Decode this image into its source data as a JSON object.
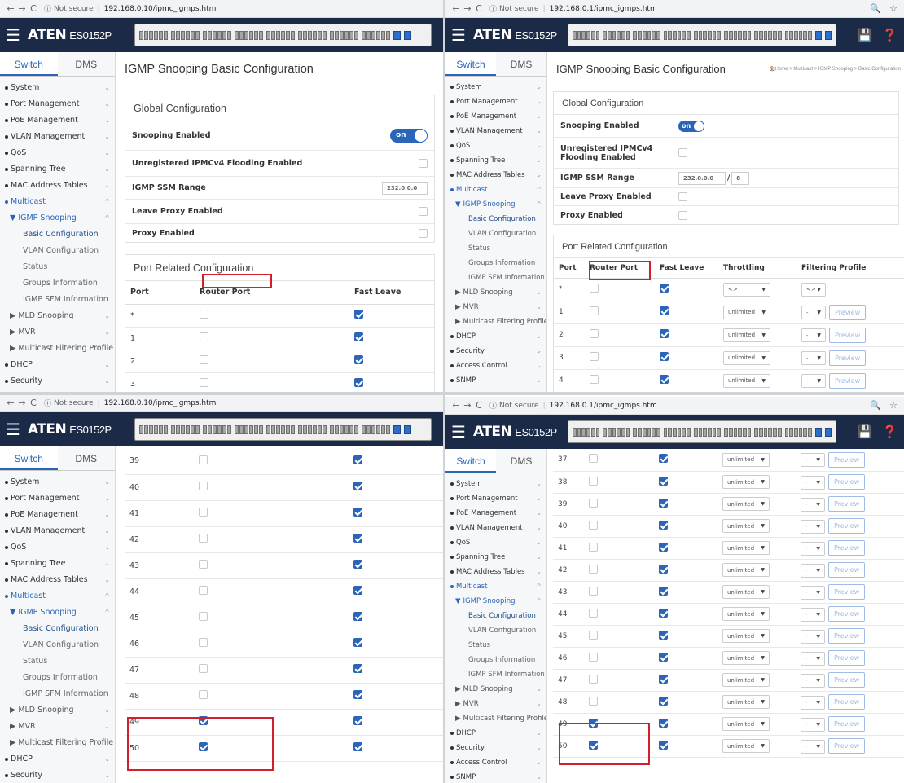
{
  "browser": {
    "q1": {
      "back": "←",
      "fwd": "→",
      "reload": "C",
      "info": "ⓘ",
      "security": "Not secure",
      "url": "192.168.0.10/ipmc_igmps.htm"
    },
    "q2": {
      "back": "←",
      "fwd": "→",
      "reload": "C",
      "info": "ⓘ",
      "security": "Not secure",
      "url": "192.168.0.1/ipmc_igmps.htm"
    },
    "q3": {
      "back": "←",
      "fwd": "→",
      "reload": "C",
      "info": "ⓘ",
      "security": "Not secure",
      "url": "192.168.0.10/ipmc_igmps.htm"
    },
    "q4": {
      "back": "←",
      "fwd": "→",
      "reload": "C",
      "info": "ⓘ",
      "security": "Not secure",
      "url": "192.168.0.1/ipmc_igmps.htm"
    }
  },
  "brand": {
    "logo": "ATEN",
    "model": "ES0152P",
    "menu_icon": "hamburger-icon"
  },
  "header_icons": {
    "save": "💾",
    "help": "❓"
  },
  "tabs": {
    "switch": "Switch",
    "dms": "DMS"
  },
  "menu": {
    "system": "System",
    "port_mgmt": "Port Management",
    "poe_mgmt": "PoE Management",
    "vlan_mgmt": "VLAN Management",
    "qos": "QoS",
    "spanning_tree": "Spanning Tree",
    "mac_tables": "MAC Address Tables",
    "multicast": "Multicast",
    "igmp_snooping": "IGMP Snooping",
    "basic_config": "Basic Configuration",
    "vlan_config": "VLAN Configuration",
    "status": "Status",
    "groups_info": "Groups Information",
    "igmp_sfm": "IGMP SFM Information",
    "mld_snooping": "MLD Snooping",
    "mvr": "MVR",
    "mfp": "Multicast Filtering Profile",
    "dhcp": "DHCP",
    "security": "Security",
    "access_control": "Access Control",
    "snmp": "SNMP"
  },
  "page": {
    "title": "IGMP Snooping Basic Configuration",
    "breadcrumb": "🏠Home > Multicast > IGMP Snooping > Basic Configuration"
  },
  "global": {
    "heading": "Global Configuration",
    "snooping_label": "Snooping Enabled",
    "snooping_toggle": "on",
    "unreg_label": "Unregistered IPMCv4 Flooding Enabled",
    "ssm_label": "IGMP SSM Range",
    "ssm_value": "232.0.0.0",
    "ssm_mask": "8",
    "leave_proxy_label": "Leave Proxy Enabled",
    "proxy_label": "Proxy Enabled"
  },
  "port_config": {
    "heading": "Port Related Configuration",
    "col_port": "Port",
    "col_router": "Router Port",
    "col_fast_leave": "Fast Leave",
    "col_throttling": "Throttling",
    "col_filtering": "Filtering Profile",
    "wildcard_throttle": "<>",
    "wildcard_filter": "<>",
    "throttle_value": "unlimited",
    "filter_value": "-",
    "preview_label": "Preview"
  },
  "q1_rows": [
    {
      "port": "*",
      "router": false,
      "fast": true
    },
    {
      "port": "1",
      "router": false,
      "fast": true
    },
    {
      "port": "2",
      "router": false,
      "fast": true
    },
    {
      "port": "3",
      "router": false,
      "fast": true
    }
  ],
  "q2_rows": [
    {
      "port": "*",
      "router": false,
      "fast": true
    },
    {
      "port": "1",
      "router": false,
      "fast": true
    },
    {
      "port": "2",
      "router": false,
      "fast": true
    },
    {
      "port": "3",
      "router": false,
      "fast": true
    },
    {
      "port": "4",
      "router": false,
      "fast": true
    }
  ],
  "q3_rows": [
    {
      "port": "39",
      "router": false,
      "fast": true
    },
    {
      "port": "40",
      "router": false,
      "fast": true
    },
    {
      "port": "41",
      "router": false,
      "fast": true
    },
    {
      "port": "42",
      "router": false,
      "fast": true
    },
    {
      "port": "43",
      "router": false,
      "fast": true
    },
    {
      "port": "44",
      "router": false,
      "fast": true
    },
    {
      "port": "45",
      "router": false,
      "fast": true
    },
    {
      "port": "46",
      "router": false,
      "fast": true
    },
    {
      "port": "47",
      "router": false,
      "fast": true
    },
    {
      "port": "48",
      "router": false,
      "fast": true
    },
    {
      "port": "49",
      "router": true,
      "fast": true
    },
    {
      "port": "50",
      "router": true,
      "fast": true
    }
  ],
  "q4_rows": [
    {
      "port": "37",
      "router": false,
      "fast": true
    },
    {
      "port": "38",
      "router": false,
      "fast": true
    },
    {
      "port": "39",
      "router": false,
      "fast": true
    },
    {
      "port": "40",
      "router": false,
      "fast": true
    },
    {
      "port": "41",
      "router": false,
      "fast": true
    },
    {
      "port": "42",
      "router": false,
      "fast": true
    },
    {
      "port": "43",
      "router": false,
      "fast": true
    },
    {
      "port": "44",
      "router": false,
      "fast": true
    },
    {
      "port": "45",
      "router": false,
      "fast": true
    },
    {
      "port": "46",
      "router": false,
      "fast": true
    },
    {
      "port": "47",
      "router": false,
      "fast": true
    },
    {
      "port": "48",
      "router": false,
      "fast": true
    },
    {
      "port": "49",
      "router": true,
      "fast": true
    },
    {
      "port": "50",
      "router": true,
      "fast": true
    }
  ],
  "colors": {
    "header_bg": "#1b2a47",
    "accent": "#2b65b9",
    "highlight": "#d0202a"
  }
}
